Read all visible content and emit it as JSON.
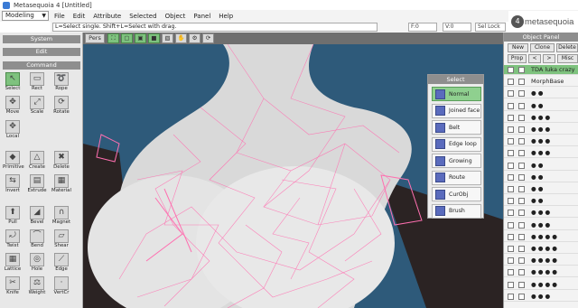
{
  "app_title": "Metasequoia 4 [Untitled]",
  "mode": "Modeling",
  "menu": [
    "File",
    "Edit",
    "Attribute",
    "Selected",
    "Object",
    "Panel",
    "Help"
  ],
  "status_text": "L=Select single.  Shift+L=Select with drag.",
  "status_fields": {
    "f": "F:0",
    "v": "V:0",
    "sel_lock": "Sel Lock"
  },
  "logo_text": "metasequoia",
  "logo_num": "4",
  "toolbar": {
    "pers": "Pers"
  },
  "left_panel": {
    "sections": [
      "System",
      "Edit",
      "Command"
    ],
    "tools": [
      {
        "label": "Select",
        "icon": "arrow-icon",
        "glyph": "↖"
      },
      {
        "label": "Rect",
        "icon": "rect-icon",
        "glyph": "▭"
      },
      {
        "label": "Rope",
        "icon": "rope-icon",
        "glyph": "➰"
      },
      {
        "label": "Move",
        "icon": "move-icon",
        "glyph": "✥"
      },
      {
        "label": "Scale",
        "icon": "scale-icon",
        "glyph": "⤢"
      },
      {
        "label": "Rotate",
        "icon": "rotate-icon",
        "glyph": "⟳"
      },
      {
        "label": "Local",
        "icon": "local-icon",
        "glyph": "✥"
      },
      {
        "label": "Primitive",
        "icon": "primitive-icon",
        "glyph": "◆"
      },
      {
        "label": "Create",
        "icon": "create-icon",
        "glyph": "△"
      },
      {
        "label": "Delete",
        "icon": "delete-icon",
        "glyph": "✖"
      },
      {
        "label": "Invert",
        "icon": "invert-icon",
        "glyph": "⇆"
      },
      {
        "label": "Extrude",
        "icon": "extrude-icon",
        "glyph": "▤"
      },
      {
        "label": "Material",
        "icon": "material-icon",
        "glyph": "▦"
      },
      {
        "label": "Pull",
        "icon": "pull-icon",
        "glyph": "⬆"
      },
      {
        "label": "Bevel",
        "icon": "bevel-icon",
        "glyph": "◢"
      },
      {
        "label": "Magnet",
        "icon": "magnet-icon",
        "glyph": "∩"
      },
      {
        "label": "Twist",
        "icon": "twist-icon",
        "glyph": "⤾"
      },
      {
        "label": "Bend",
        "icon": "bend-icon",
        "glyph": "⌒"
      },
      {
        "label": "Shear",
        "icon": "shear-icon",
        "glyph": "▱"
      },
      {
        "label": "Lattice",
        "icon": "lattice-icon",
        "glyph": "▦"
      },
      {
        "label": "Hole",
        "icon": "hole-icon",
        "glyph": "◎"
      },
      {
        "label": "Edge",
        "icon": "edge-icon",
        "glyph": "⟋"
      },
      {
        "label": "Knife",
        "icon": "knife-icon",
        "glyph": "✂"
      },
      {
        "label": "Weight",
        "icon": "weight-icon",
        "glyph": "⚖"
      },
      {
        "label": "VertCr",
        "icon": "vertex-icon",
        "glyph": "·"
      }
    ]
  },
  "select_panel": {
    "title": "Select",
    "items": [
      "Normal",
      "Joined face",
      "Belt",
      "Edge loop",
      "Growing",
      "Route",
      "CurObj",
      "Brush"
    ],
    "selected_index": 0
  },
  "object_panel": {
    "title": "Object Panel",
    "buttons_row1": [
      "New",
      "Clone",
      "Delete"
    ],
    "buttons_row2": [
      "Prop",
      "<",
      ">",
      "Misc"
    ],
    "objects": [
      {
        "name": "TDA luka crazy",
        "highlight": true
      },
      {
        "name": "MorphBase",
        "highlight": false
      },
      {
        "name": "● ●",
        "highlight": false
      },
      {
        "name": "● ●",
        "highlight": false
      },
      {
        "name": "● ● ●",
        "highlight": false
      },
      {
        "name": "● ● ●",
        "highlight": false
      },
      {
        "name": "● ● ●",
        "highlight": false
      },
      {
        "name": "● ● ●",
        "highlight": false
      },
      {
        "name": "● ●",
        "highlight": false
      },
      {
        "name": "● ●",
        "highlight": false
      },
      {
        "name": "● ●",
        "highlight": false
      },
      {
        "name": "● ●",
        "highlight": false
      },
      {
        "name": "● ● ●",
        "highlight": false
      },
      {
        "name": "● ● ●",
        "highlight": false
      },
      {
        "name": "● ● ● ●",
        "highlight": false
      },
      {
        "name": "● ● ● ●",
        "highlight": false
      },
      {
        "name": "● ● ● ●",
        "highlight": false
      },
      {
        "name": "● ● ● ●",
        "highlight": false
      },
      {
        "name": "● ● ● ●",
        "highlight": false
      },
      {
        "name": "● ● ●",
        "highlight": false
      }
    ]
  },
  "colors": {
    "accent_green": "#7ec27e",
    "viewport_bg": "#2e5a7a",
    "wire": "#ff6fb0"
  }
}
